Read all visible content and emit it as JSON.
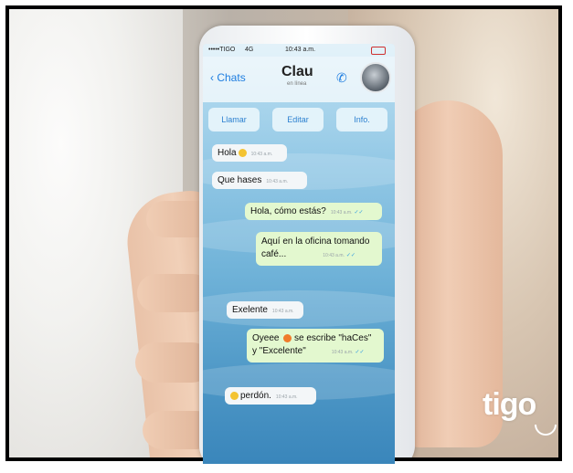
{
  "status_bar": {
    "carrier": "•••••TIGO",
    "network": "4G",
    "time": "10:43 a.m."
  },
  "header": {
    "back_label": "Chats",
    "contact_name": "Clau",
    "contact_status": "en línea"
  },
  "actions": [
    {
      "label": "Llamar"
    },
    {
      "label": "Editar"
    },
    {
      "label": "Info."
    }
  ],
  "messages": [
    {
      "direction": "in",
      "text": "Hola",
      "time": "10:43 a.m.",
      "emoji": "smile"
    },
    {
      "direction": "in",
      "text": "Que hases",
      "time": "10:43 a.m."
    },
    {
      "direction": "out",
      "text": "Hola, cómo estás?",
      "time": "10:43 a.m."
    },
    {
      "direction": "out",
      "line1": "Aquí en la oficina tomando",
      "line2": "café...",
      "time": "10:43 a.m."
    },
    {
      "direction": "in",
      "text": "Exelente",
      "time": "10:43 a.m."
    },
    {
      "direction": "out",
      "line1_pre": "Oyeee",
      "line1_post": "se escribe \"haCes\"",
      "line2": "y \"Excelente\"",
      "time": "10:43 a.m.",
      "emoji": "angry"
    },
    {
      "direction": "in",
      "text": "perdón.",
      "time": "10:43 a.m.",
      "emoji": "blush"
    }
  ],
  "brand": {
    "logo_text": "tigo"
  },
  "colors": {
    "accent": "#1e7de0",
    "incoming": "#f3f6f8",
    "outgoing": "#e3f8cf"
  }
}
